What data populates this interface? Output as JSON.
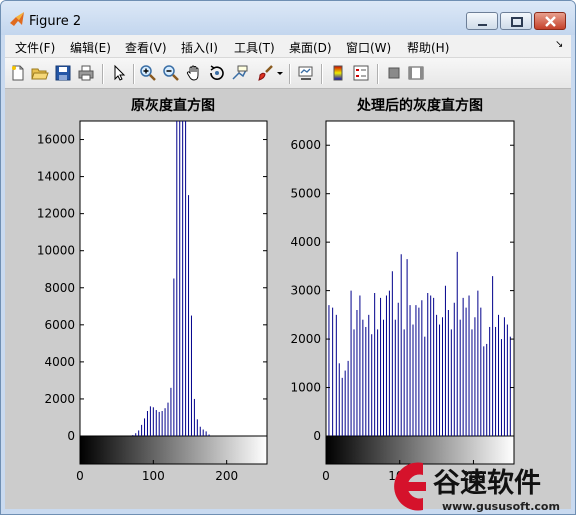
{
  "window": {
    "title": "Figure 2"
  },
  "menu": [
    "文件(F)",
    "编辑(E)",
    "查看(V)",
    "插入(I)",
    "工具(T)",
    "桌面(D)",
    "窗口(W)",
    "帮助(H)"
  ],
  "menu_overflow": "↘",
  "toolbar": {
    "tools": [
      "new-figure",
      "open-file",
      "save",
      "print",
      "edit-plot-arrow",
      "zoom-in",
      "zoom-out",
      "pan",
      "rotate-3d",
      "data-cursor",
      "brush",
      "brush-dropdown",
      "link-plot",
      "colorbar",
      "legend",
      "hide-plot-tools",
      "show-plot-tools"
    ]
  },
  "chart_data": [
    {
      "type": "bar",
      "title": "原灰度直方图",
      "xlabel": "",
      "ylabel": "",
      "xlim": [
        0,
        255
      ],
      "ylim": [
        0,
        17000
      ],
      "yticks": [
        0,
        2000,
        4000,
        6000,
        8000,
        10000,
        12000,
        14000,
        16000
      ],
      "xticks": [
        0,
        100,
        200
      ],
      "bar_color": "#00008b",
      "colorbar": "gray",
      "x": [
        72,
        76,
        80,
        84,
        88,
        92,
        96,
        100,
        104,
        108,
        112,
        116,
        120,
        124,
        128,
        132,
        136,
        140,
        144,
        148,
        152,
        156,
        160,
        164,
        168,
        172,
        176
      ],
      "values": [
        50,
        150,
        300,
        600,
        950,
        1350,
        1600,
        1550,
        1400,
        1300,
        1350,
        1500,
        1800,
        2600,
        8500,
        17000,
        17000,
        17000,
        17000,
        13000,
        6500,
        2000,
        900,
        500,
        350,
        250,
        80
      ]
    },
    {
      "type": "bar",
      "title": "处理后的灰度直方图",
      "xlabel": "",
      "ylabel": "",
      "xlim": [
        0,
        255
      ],
      "ylim": [
        0,
        6500
      ],
      "yticks": [
        0,
        1000,
        2000,
        3000,
        4000,
        5000,
        6000
      ],
      "xticks": [
        0,
        100,
        200
      ],
      "bar_color": "#00008b",
      "colorbar": "gray",
      "x": [
        4,
        9,
        14,
        18,
        22,
        26,
        30,
        34,
        38,
        42,
        46,
        50,
        54,
        58,
        62,
        66,
        70,
        74,
        78,
        82,
        86,
        90,
        94,
        98,
        102,
        106,
        110,
        114,
        118,
        122,
        126,
        130,
        134,
        138,
        142,
        146,
        150,
        154,
        158,
        162,
        166,
        170,
        174,
        178,
        182,
        186,
        190,
        194,
        198,
        202,
        206,
        210,
        214,
        218,
        222,
        226,
        230,
        234,
        238,
        242,
        246,
        250
      ],
      "values": [
        2700,
        2650,
        2500,
        1500,
        1200,
        1350,
        1550,
        3000,
        2200,
        2600,
        2900,
        2400,
        2250,
        2500,
        2100,
        2950,
        2200,
        2850,
        2400,
        2900,
        3000,
        3400,
        2400,
        2750,
        3750,
        2200,
        3650,
        2700,
        2300,
        2700,
        2650,
        2800,
        2050,
        2950,
        2900,
        2850,
        2500,
        2300,
        2450,
        3100,
        2600,
        2200,
        2750,
        3800,
        2400,
        2850,
        2650,
        2900,
        2200,
        2450,
        3000,
        2650,
        1850,
        1900,
        2250,
        3300,
        2250,
        2500,
        2000,
        2450,
        2300,
        2050
      ]
    }
  ],
  "watermark": {
    "brand": "谷速软件",
    "url": "www.gususoft.com"
  }
}
